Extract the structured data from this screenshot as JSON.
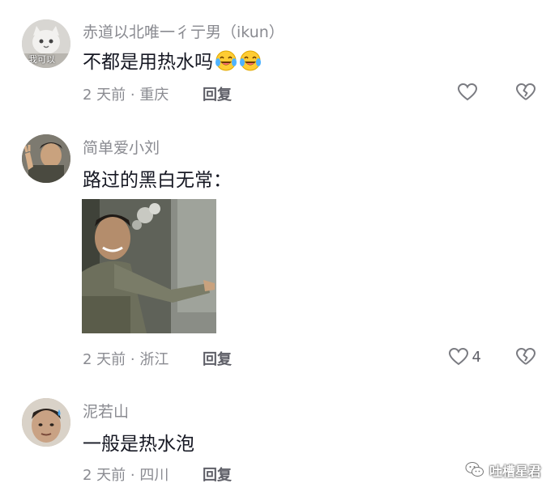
{
  "comments": [
    {
      "author": "赤道以北唯一彳亍男（ikun）",
      "text": "不都是用热水吗",
      "emoji_count": 2,
      "meta": "2 天前 · 重庆",
      "reply_label": "回复",
      "like_count": ""
    },
    {
      "author": "简单爱小刘",
      "text": "路过的黑白无常：",
      "meta": "2 天前 · 浙江",
      "reply_label": "回复",
      "like_count": "4"
    },
    {
      "author": "泥若山",
      "text": "一般是热水泡",
      "meta": "2 天前 · 四川",
      "reply_label": "回复",
      "like_count": ""
    }
  ],
  "avatar1_caption": "我可以",
  "watermark": {
    "label": "吐槽星君"
  },
  "icons": {
    "like": "heart-outline-icon",
    "dislike": "broken-heart-icon",
    "emoji": "laughing-tears-emoji-icon",
    "watermark": "wechat-icon"
  }
}
